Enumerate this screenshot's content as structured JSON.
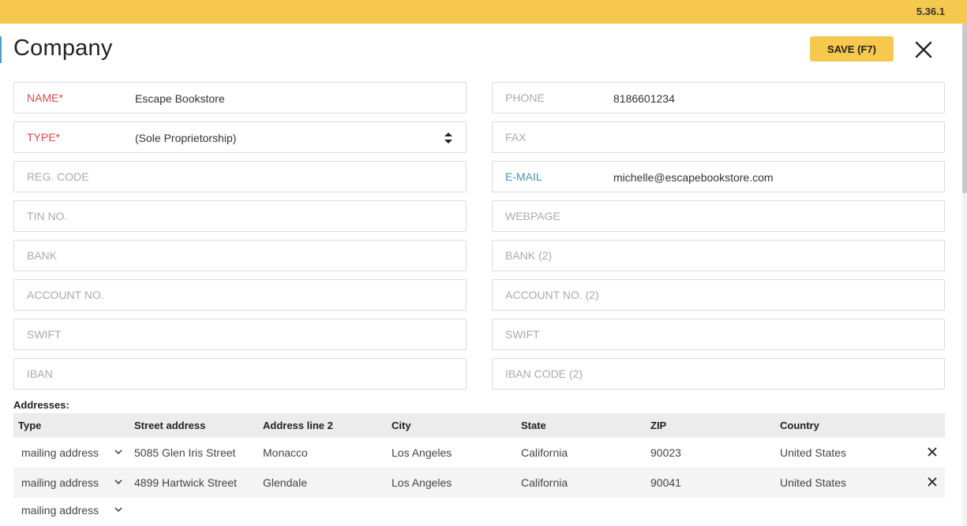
{
  "app": {
    "version": "5.36.1"
  },
  "page": {
    "title": "Company"
  },
  "toolbar": {
    "save_label": "SAVE (F7)"
  },
  "form": {
    "left": [
      {
        "label": "NAME*",
        "value": "Escape Bookstore"
      },
      {
        "label": "TYPE*",
        "value": "(Sole Proprietorship)"
      },
      {
        "label": "REG. CODE",
        "value": ""
      },
      {
        "label": "TIN NO.",
        "value": ""
      },
      {
        "label": "BANK",
        "value": ""
      },
      {
        "label": "ACCOUNT NO.",
        "value": ""
      },
      {
        "label": "SWIFT",
        "value": ""
      },
      {
        "label": "IBAN",
        "value": ""
      }
    ],
    "right": [
      {
        "label": "PHONE",
        "value": "8186601234"
      },
      {
        "label": "FAX",
        "value": ""
      },
      {
        "label": "E-MAIL",
        "value": "michelle@escapebookstore.com"
      },
      {
        "label": "WEBPAGE",
        "value": ""
      },
      {
        "label": "BANK (2)",
        "value": ""
      },
      {
        "label": "ACCOUNT NO. (2)",
        "value": ""
      },
      {
        "label": "SWIFT",
        "value": ""
      },
      {
        "label": "IBAN CODE (2)",
        "value": ""
      }
    ]
  },
  "addresses": {
    "title": "Addresses:",
    "headers": [
      "Type",
      "Street address",
      "Address line 2",
      "City",
      "State",
      "ZIP",
      "Country"
    ],
    "rows": [
      {
        "type": "mailing address",
        "street": "5085 Glen Iris Street",
        "line2": "Monacco",
        "city": "Los Angeles",
        "state": "California",
        "zip": "90023",
        "country": "United States"
      },
      {
        "type": "mailing address",
        "street": "4899 Hartwick Street",
        "line2": "Glendale",
        "city": "Los Angeles",
        "state": "California",
        "zip": "90041",
        "country": "United States"
      }
    ],
    "new_row_type": "mailing address"
  },
  "colors": {
    "accent": "#f7c84e",
    "required": "#d94a4a",
    "link": "#4a90b8"
  }
}
